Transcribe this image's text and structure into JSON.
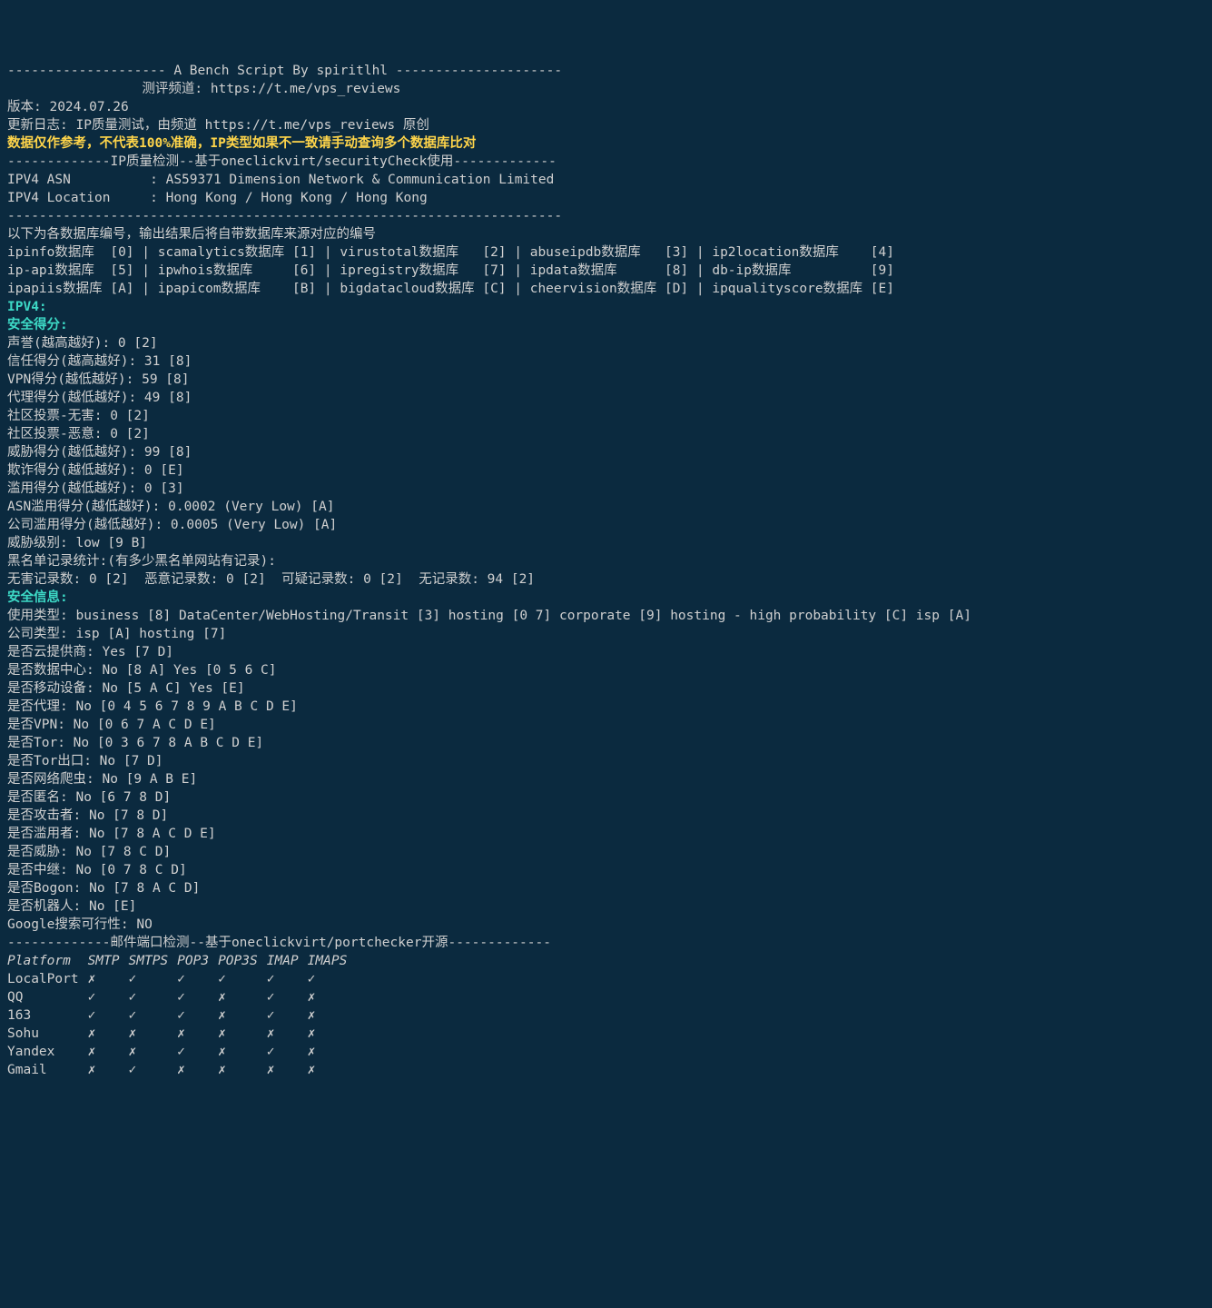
{
  "header": {
    "title_line": "-------------------- A Bench Script By spiritlhl ---------------------",
    "channel_line": "                 测评频道: https://t.me/vps_reviews",
    "version_line": "版本: 2024.07.26",
    "changelog_line": "更新日志: IP质量测试，由频道 https://t.me/vps_reviews 原创",
    "warning_line": "数据仅作参考，不代表100%准确，IP类型如果不一致请手动查询多个数据库比对"
  },
  "ipq_header": "-------------IP质量检测--基于oneclickvirt/securityCheck使用-------------",
  "ipv4_asn": "IPV4 ASN          : AS59371 Dimension Network & Communication Limited",
  "ipv4_location": "IPV4 Location     : Hong Kong / Hong Kong / Hong Kong",
  "divider1": "----------------------------------------------------------------------",
  "db_intro": "以下为各数据库编号，输出结果后将自带数据库来源对应的编号",
  "db_lines": [
    "ipinfo数据库  [0] | scamalytics数据库 [1] | virustotal数据库   [2] | abuseipdb数据库   [3] | ip2location数据库    [4]",
    "ip-api数据库  [5] | ipwhois数据库     [6] | ipregistry数据库   [7] | ipdata数据库      [8] | db-ip数据库          [9]",
    "ipapiis数据库 [A] | ipapicom数据库    [B] | bigdatacloud数据库 [C] | cheervision数据库 [D] | ipqualityscore数据库 [E]"
  ],
  "ipv4_label": "IPV4:",
  "sec_score_label": "安全得分:",
  "sec_scores": [
    "声誉(越高越好): 0 [2]",
    "信任得分(越高越好): 31 [8]",
    "VPN得分(越低越好): 59 [8]",
    "代理得分(越低越好): 49 [8]",
    "社区投票-无害: 0 [2]",
    "社区投票-恶意: 0 [2]",
    "威胁得分(越低越好): 99 [8]",
    "欺诈得分(越低越好): 0 [E]",
    "滥用得分(越低越好): 0 [3]",
    "ASN滥用得分(越低越好): 0.0002 (Very Low) [A]",
    "公司滥用得分(越低越好): 0.0005 (Very Low) [A]",
    "威胁级别: low [9 B]",
    "黑名单记录统计:(有多少黑名单网站有记录):",
    "无害记录数: 0 [2]  恶意记录数: 0 [2]  可疑记录数: 0 [2]  无记录数: 94 [2]"
  ],
  "sec_info_label": "安全信息:",
  "sec_info": [
    "使用类型: business [8] DataCenter/WebHosting/Transit [3] hosting [0 7] corporate [9] hosting - high probability [C] isp [A]",
    "公司类型: isp [A] hosting [7]",
    "是否云提供商: Yes [7 D]",
    "是否数据中心: No [8 A] Yes [0 5 6 C]",
    "是否移动设备: No [5 A C] Yes [E]",
    "是否代理: No [0 4 5 6 7 8 9 A B C D E]",
    "是否VPN: No [0 6 7 A C D E]",
    "是否Tor: No [0 3 6 7 8 A B C D E]",
    "是否Tor出口: No [7 D]",
    "是否网络爬虫: No [9 A B E]",
    "是否匿名: No [6 7 8 D]",
    "是否攻击者: No [7 8 D]",
    "是否滥用者: No [7 8 A C D E]",
    "是否威胁: No [7 8 C D]",
    "是否中继: No [0 7 8 C D]",
    "是否Bogon: No [7 8 A C D]",
    "是否机器人: No [E]",
    "Google搜索可行性: NO"
  ],
  "port_header": "-------------邮件端口检测--基于oneclickvirt/portchecker开源-------------",
  "port_table": {
    "headers": [
      "Platform",
      "SMTP",
      "SMTPS",
      "POP3",
      "POP3S",
      "IMAP",
      "IMAPS"
    ],
    "rows": [
      [
        "LocalPort",
        "✗",
        "✓",
        "✓",
        "✓",
        "✓",
        "✓"
      ],
      [
        "QQ",
        "✓",
        "✓",
        "✓",
        "✗",
        "✓",
        "✗"
      ],
      [
        "163",
        "✓",
        "✓",
        "✓",
        "✗",
        "✓",
        "✗"
      ],
      [
        "Sohu",
        "✗",
        "✗",
        "✗",
        "✗",
        "✗",
        "✗"
      ],
      [
        "Yandex",
        "✗",
        "✗",
        "✓",
        "✗",
        "✓",
        "✗"
      ],
      [
        "Gmail",
        "✗",
        "✓",
        "✗",
        "✗",
        "✗",
        "✗"
      ]
    ]
  }
}
